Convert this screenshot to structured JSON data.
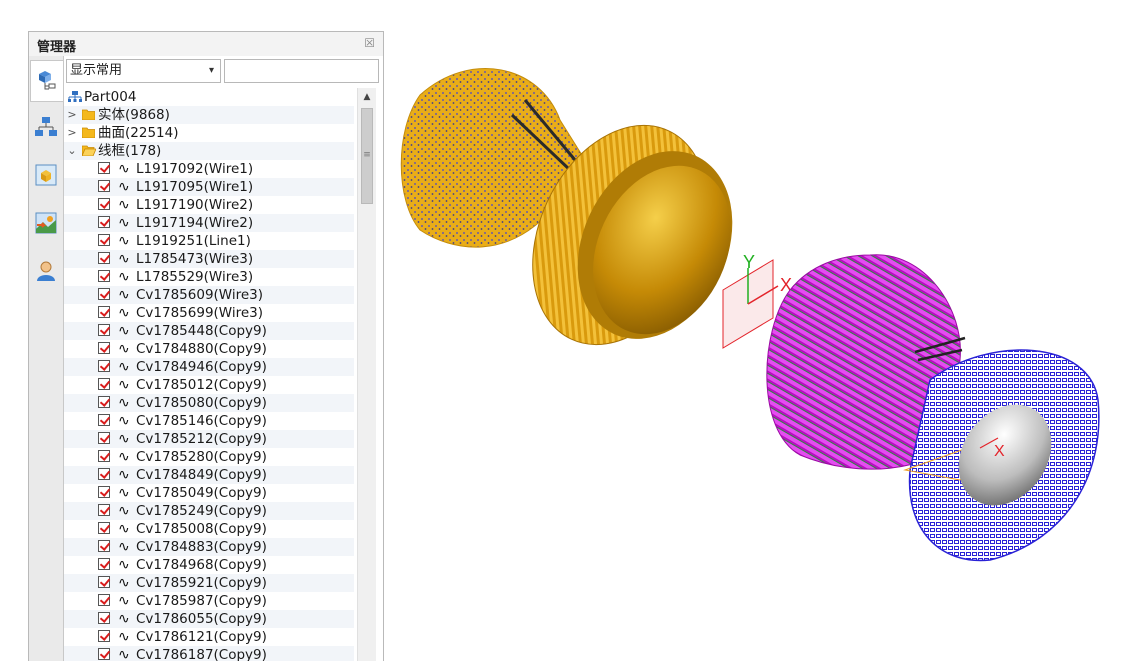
{
  "manager": {
    "title": "管理器",
    "close_glyph": "☒",
    "filter": {
      "selected": "显示常用",
      "search_value": ""
    },
    "root": {
      "label": "Part004"
    },
    "groups": [
      {
        "label": "实体(9868)",
        "state": "collapsed"
      },
      {
        "label": "曲面(22514)",
        "state": "collapsed"
      },
      {
        "label": "线框(178)",
        "state": "expanded"
      }
    ],
    "wireframe_items": [
      "L1917092(Wire1)",
      "L1917095(Wire1)",
      "L1917190(Wire2)",
      "L1917194(Wire2)",
      "L1919251(Line1)",
      "L1785473(Wire3)",
      "L1785529(Wire3)",
      "Cv1785609(Wire3)",
      "Cv1785699(Wire3)",
      "Cv1785448(Copy9)",
      "Cv1784880(Copy9)",
      "Cv1784946(Copy9)",
      "Cv1785012(Copy9)",
      "Cv1785080(Copy9)",
      "Cv1785146(Copy9)",
      "Cv1785212(Copy9)",
      "Cv1785280(Copy9)",
      "Cv1784849(Copy9)",
      "Cv1785049(Copy9)",
      "Cv1785249(Copy9)",
      "Cv1785008(Copy9)",
      "Cv1784883(Copy9)",
      "Cv1784968(Copy9)",
      "Cv1785921(Copy9)",
      "Cv1785987(Copy9)",
      "Cv1786055(Copy9)",
      "Cv1786121(Copy9)",
      "Cv1786187(Copy9)"
    ],
    "sidebar_tabs": [
      "history-tree-icon",
      "assembly-icon",
      "view-icon",
      "image-icon",
      "user-icon"
    ]
  },
  "viewport": {
    "triad": {
      "x_label": "X",
      "y_label": "Y"
    },
    "small_triad": {
      "x_label": "X"
    },
    "colors": {
      "gold": "#e2a411",
      "magenta": "#c218c9",
      "blue": "#3c2fe0",
      "axis_red": "#e3242b",
      "axis_green": "#21b021"
    }
  }
}
